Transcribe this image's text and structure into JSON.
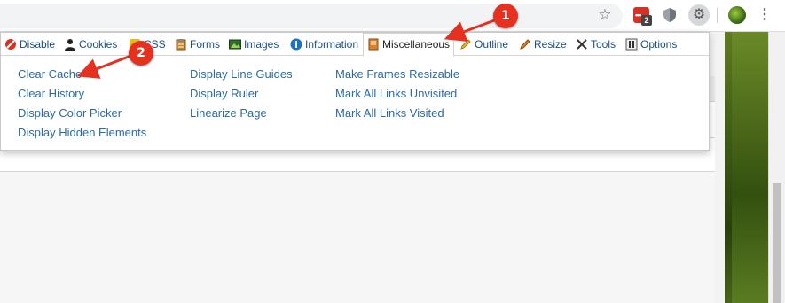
{
  "browser": {
    "extension_badge_count": "2",
    "accent_color": "#d93025"
  },
  "devtools_popup": {
    "tabs": [
      {
        "label": "Disable",
        "icon": "disable-icon"
      },
      {
        "label": "Cookies",
        "icon": "cookies-icon"
      },
      {
        "label": "CSS",
        "icon": "css-icon"
      },
      {
        "label": "Forms",
        "icon": "forms-icon"
      },
      {
        "label": "Images",
        "icon": "images-icon"
      },
      {
        "label": "Information",
        "icon": "information-icon"
      },
      {
        "label": "Miscellaneous",
        "icon": "miscellaneous-icon",
        "active": true
      },
      {
        "label": "Outline",
        "icon": "outline-icon"
      },
      {
        "label": "Resize",
        "icon": "resize-icon"
      },
      {
        "label": "Tools",
        "icon": "tools-icon"
      },
      {
        "label": "Options",
        "icon": "options-icon"
      }
    ],
    "menu_columns": [
      [
        "Clear Cache",
        "Clear History",
        "Display Color Picker",
        "Display Hidden Elements"
      ],
      [
        "Display Line Guides",
        "Display Ruler",
        "Linearize Page"
      ],
      [
        "Make Frames Resizable",
        "Mark All Links Unvisited",
        "Mark All Links Visited"
      ]
    ],
    "link_color": "#2c6aa7"
  },
  "callouts": [
    {
      "number": "1"
    },
    {
      "number": "2"
    }
  ],
  "callout_color": "#e53120",
  "editor_toolbar_icons": [
    "align-right-icon",
    "align-justify-icon",
    "bullet-list-icon",
    "chevron-down-icon",
    "numbered-list-icon",
    "chevron-down-icon",
    "outdent-icon",
    "indent-icon",
    "link-icon",
    "unlink-icon",
    "image-icon",
    "media-icon",
    "code-icon",
    "preview-icon"
  ]
}
